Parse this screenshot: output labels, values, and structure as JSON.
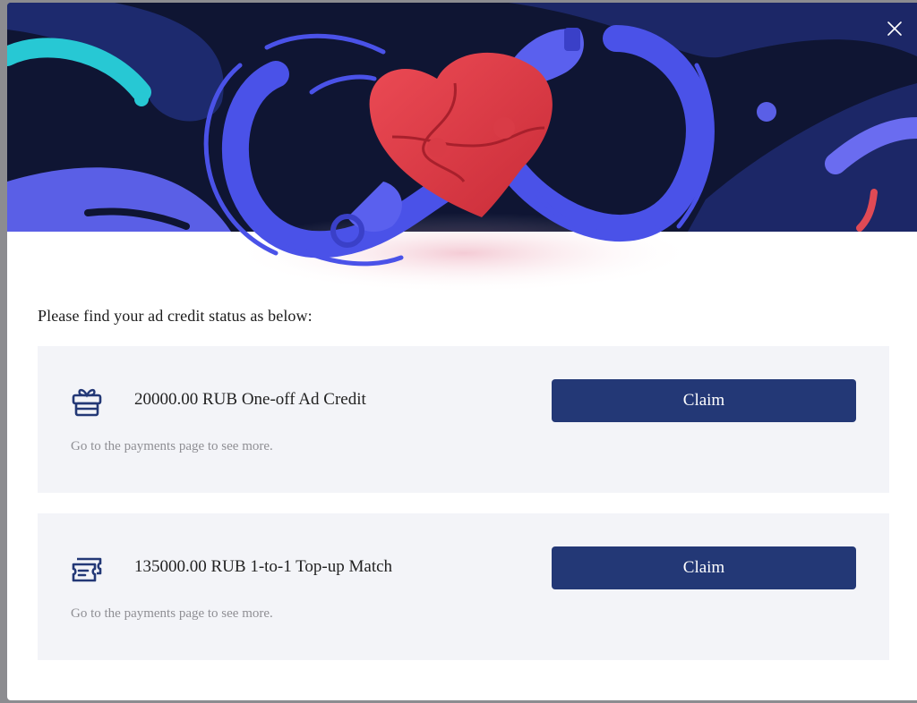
{
  "modal": {
    "intro": "Please find your ad credit status as below:",
    "credits": [
      {
        "icon": "gift-icon",
        "title": "20000.00 RUB One-off Ad Credit",
        "subtitle": "Go to the payments page to see more.",
        "button": "Claim"
      },
      {
        "icon": "tickets-icon",
        "title": "135000.00 RUB 1-to-1 Top-up Match",
        "subtitle": "Go to the payments page to see more.",
        "button": "Claim"
      }
    ]
  },
  "colors": {
    "button": "#233876",
    "banner_background": "#0f1533",
    "icon": "#233876",
    "card_background": "#f3f4f8"
  }
}
